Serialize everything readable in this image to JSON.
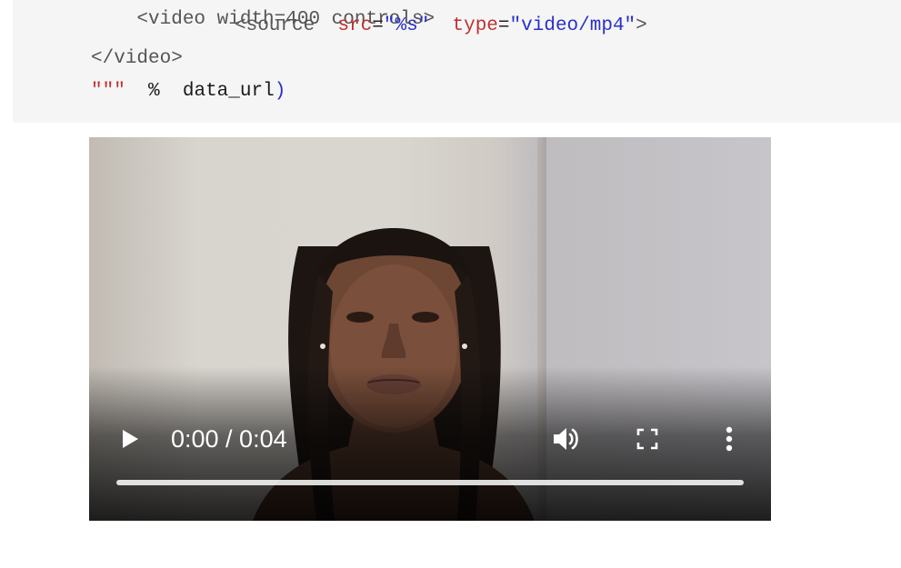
{
  "code": {
    "line0": "<video width=400 controls>",
    "source_tag": "<source",
    "src_attr": "src",
    "src_val": "\"%s\"",
    "type_attr": "type",
    "type_val": "\"video/mp4\"",
    "close_angle": ">",
    "video_close": "</video>",
    "triple_quote": "\"\"\"",
    "percent": "%",
    "var_name": "data_url",
    "paren": ")"
  },
  "video": {
    "time_display": "0:00 / 0:04",
    "progress": 0
  }
}
